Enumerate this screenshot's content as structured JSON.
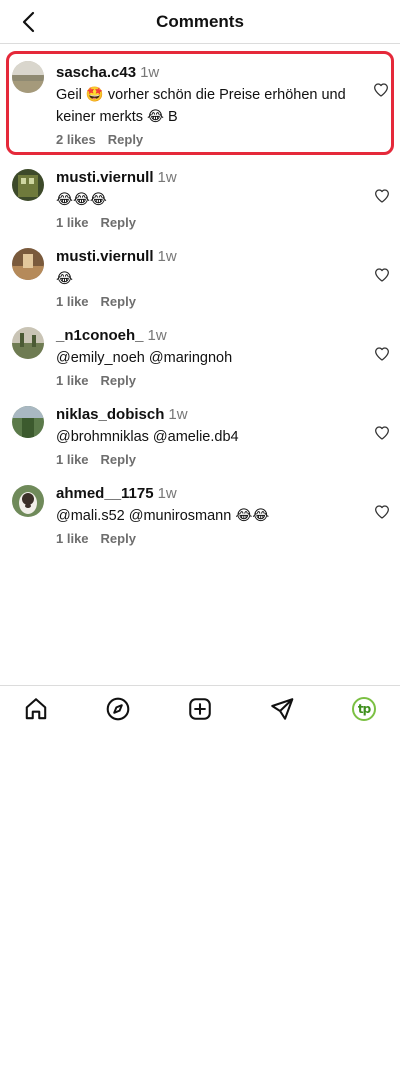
{
  "header": {
    "title": "Comments"
  },
  "comments": [
    {
      "username": "sascha.c43",
      "time": "1w",
      "text": "Geil 🤩 vorher schön die Preise erhöhen und keiner merkts 😂 B",
      "likes": "2 likes",
      "reply": "Reply"
    },
    {
      "username": "musti.viernull",
      "time": "1w",
      "text": "😂😂😂",
      "likes": "1 like",
      "reply": "Reply"
    },
    {
      "username": "musti.viernull",
      "time": "1w",
      "text": "😂",
      "likes": "1 like",
      "reply": "Reply"
    },
    {
      "username": "_n1conoeh_",
      "time": "1w",
      "text": "@emily_noeh @maringnoh",
      "likes": "1 like",
      "reply": "Reply"
    },
    {
      "username": "niklas_dobisch",
      "time": "1w",
      "text": "@brohmniklas @amelie.db4",
      "likes": "1 like",
      "reply": "Reply"
    },
    {
      "username": "ahmed__1175",
      "time": "1w",
      "text": "@mali.s52 @munirosmann 😂😂",
      "likes": "1 like",
      "reply": "Reply"
    }
  ],
  "nav": {
    "items": [
      "home-icon",
      "explore-icon",
      "create-icon",
      "direct-icon",
      "profile-icon"
    ],
    "profile_initials": "tp"
  },
  "colors": {
    "highlight": "#e5293a",
    "profile_ring": "#7bc043"
  }
}
